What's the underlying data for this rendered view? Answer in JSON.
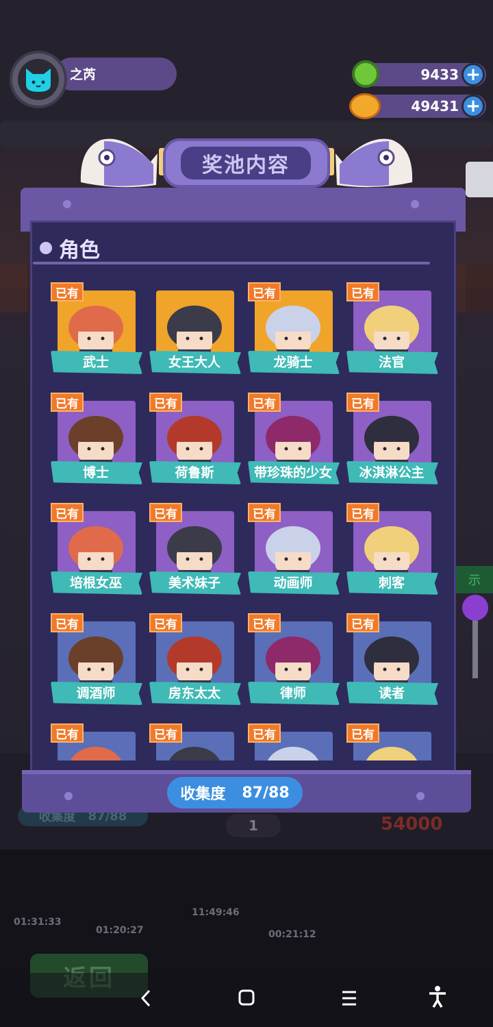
{
  "player": {
    "name": "之芮",
    "avatar_icon": "cat-face-icon"
  },
  "currencies": [
    {
      "icon": "green-gear-coin-icon",
      "value": "9433"
    },
    {
      "icon": "planet-coin-icon",
      "value": "49431"
    }
  ],
  "panel": {
    "title": "奖池内容",
    "section_title": "角色"
  },
  "characters": [
    {
      "name": "武士",
      "owned": true,
      "bg": "gold"
    },
    {
      "name": "女王大人",
      "owned": false,
      "bg": "gold"
    },
    {
      "name": "龙骑士",
      "owned": true,
      "bg": "gold"
    },
    {
      "name": "法官",
      "owned": true,
      "bg": "purple"
    },
    {
      "name": "博士",
      "owned": true,
      "bg": "purple"
    },
    {
      "name": "荷鲁斯",
      "owned": true,
      "bg": "purple"
    },
    {
      "name": "带珍珠的少女",
      "owned": true,
      "bg": "purple"
    },
    {
      "name": "冰淇淋公主",
      "owned": true,
      "bg": "purple"
    },
    {
      "name": "培根女巫",
      "owned": true,
      "bg": "purple"
    },
    {
      "name": "美术妹子",
      "owned": true,
      "bg": "purple"
    },
    {
      "name": "动画师",
      "owned": true,
      "bg": "purple"
    },
    {
      "name": "刺客",
      "owned": true,
      "bg": "purple"
    },
    {
      "name": "调酒师",
      "owned": true,
      "bg": "blue"
    },
    {
      "name": "房东太太",
      "owned": true,
      "bg": "blue"
    },
    {
      "name": "律师",
      "owned": true,
      "bg": "blue"
    },
    {
      "name": "读者",
      "owned": true,
      "bg": "blue"
    },
    {
      "name": "",
      "owned": true,
      "bg": "blue"
    },
    {
      "name": "",
      "owned": true,
      "bg": "blue"
    },
    {
      "name": "",
      "owned": true,
      "bg": "blue"
    },
    {
      "name": "",
      "owned": true,
      "bg": "blue"
    }
  ],
  "owned_label": "已有",
  "collection": {
    "label": "收集度",
    "value": "87/88"
  },
  "background": {
    "return_label": "返回",
    "progress_label": "收集度",
    "progress_value": "87/88",
    "coins": "54000",
    "count": "1",
    "timers": [
      "01:31:33",
      "01:20:27",
      "11:49:46",
      "00:21:12"
    ]
  },
  "navbar": {
    "back_icon": "back-chevron-icon",
    "home_icon": "home-square-icon",
    "recents_icon": "recents-lines-icon",
    "accessibility_icon": "accessibility-person-icon"
  }
}
